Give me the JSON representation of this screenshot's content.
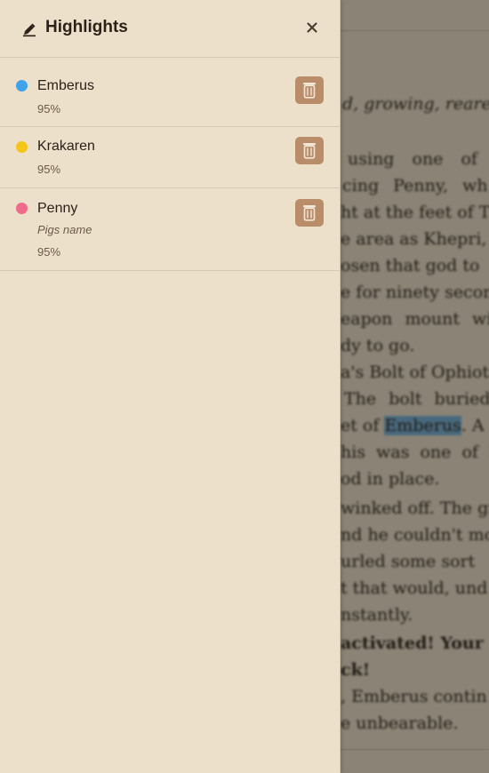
{
  "panel": {
    "title": "Highlights",
    "header_icon": "highlighter-icon",
    "close_icon": "close-icon",
    "close_symbol": "×"
  },
  "highlights": [
    {
      "name": "Emberus",
      "note": "",
      "progress": "95%",
      "color": "#3ea3ea",
      "delete_icon": "trash-icon"
    },
    {
      "name": "Krakaren",
      "note": "",
      "progress": "95%",
      "color": "#f5c518",
      "delete_icon": "trash-icon"
    },
    {
      "name": "Penny",
      "note": "Pigs name",
      "progress": "95%",
      "color": "#f06a8a",
      "delete_icon": "trash-icon"
    }
  ],
  "reader_text": {
    "lines": [
      "d, growing, reare",
      "using one of",
      "cing Penny, wh",
      "ht at the feet of Ti",
      "e area as Khepri,",
      "osen that god to",
      "e for ninety secon",
      "eapon mount wi",
      "dy to go.",
      "a's Bolt of Ophiot",
      "The bolt buried",
      "et of Emberus. A",
      "his was one of h",
      "od in place.",
      "winked off. The gr",
      "nd he couldn't mo",
      "urled some sort",
      "t that would, und",
      "nstantly.",
      "activated! Your",
      "ck!",
      ", Emberus contin",
      "e unbearable."
    ],
    "highlighted_word": "Emberus"
  },
  "colors": {
    "panel_bg": "#ede0cb",
    "delete_button": "#b98d6a",
    "reader_highlight": "#7db6d8"
  }
}
